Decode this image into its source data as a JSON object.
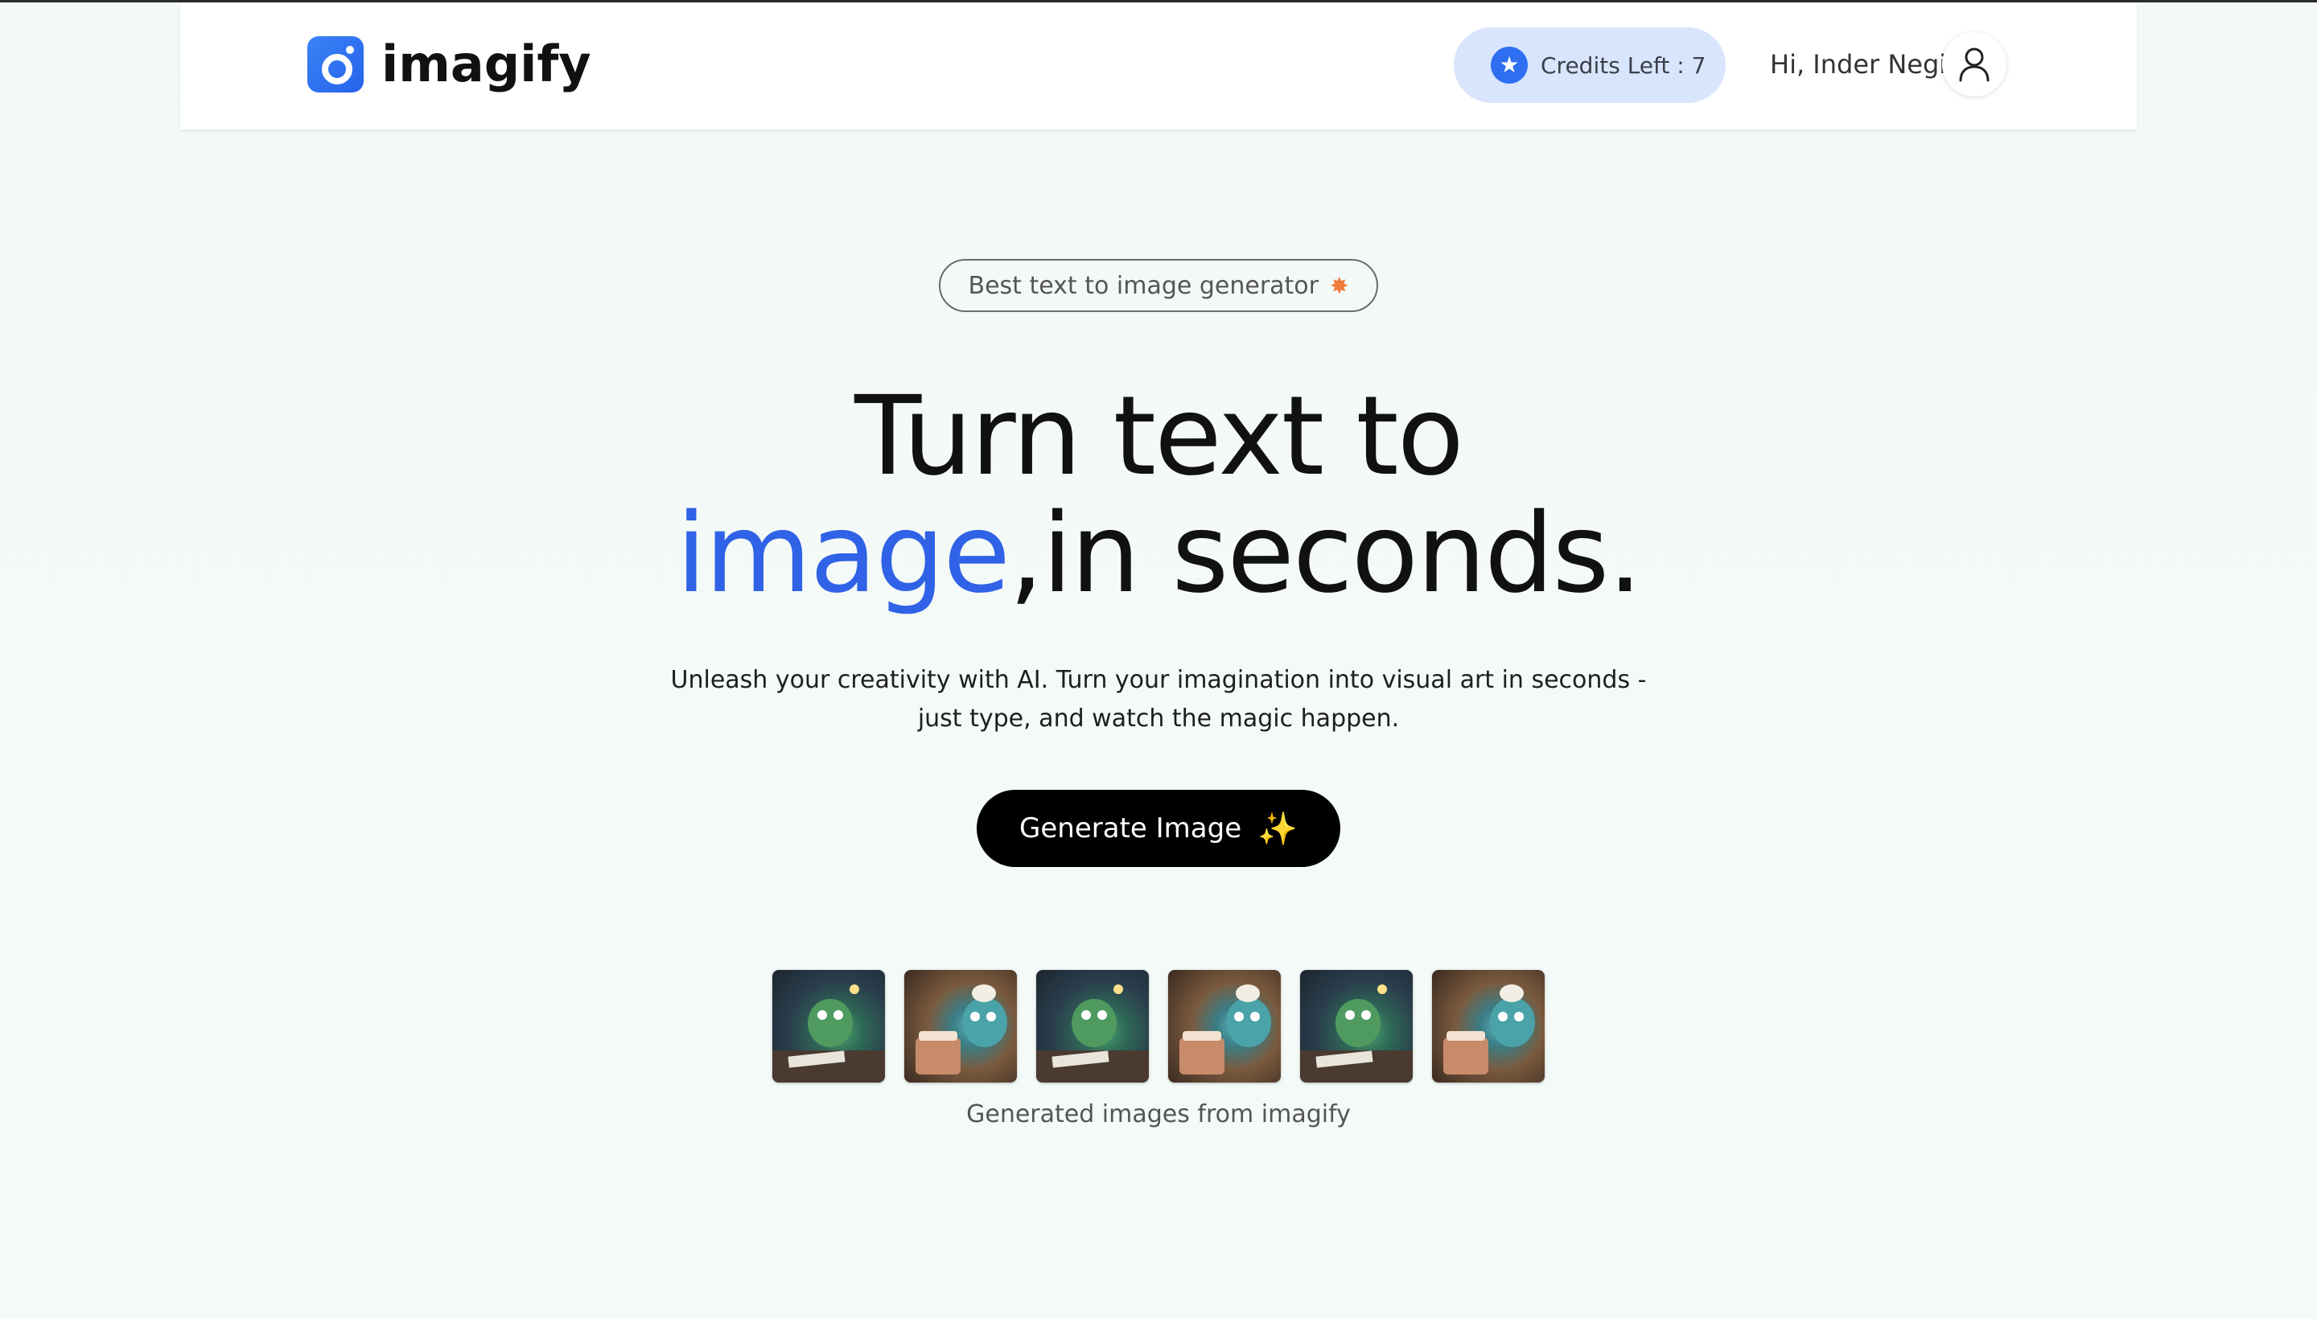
{
  "app": {
    "logo_text": "imagify"
  },
  "header": {
    "credits_label": "Credits Left : 7",
    "greeting": "Hi, Inder Negi",
    "star_icon": "star-icon",
    "user_icon": "user-icon"
  },
  "hero": {
    "badge_text": "Best text to image generator",
    "headline_line1": "Turn text to",
    "headline_accent": "image",
    "headline_rest": ",in seconds.",
    "subtitle_line1": "Unleash your creativity with AI. Turn your imagination into visual art in seconds -",
    "subtitle_line2": "just type, and watch the magic happen.",
    "button_label": "Generate Image",
    "caption": "Generated images from imagify"
  },
  "colors": {
    "accent": "#2f62e6",
    "credits_bg": "#d8e5fc",
    "button_bg": "#000000",
    "page_bg": "#f3f9f7"
  },
  "thumbnails": [
    "monster-at-desk",
    "monster-with-cake",
    "monster-at-desk",
    "monster-with-cake",
    "monster-at-desk",
    "monster-with-cake"
  ]
}
